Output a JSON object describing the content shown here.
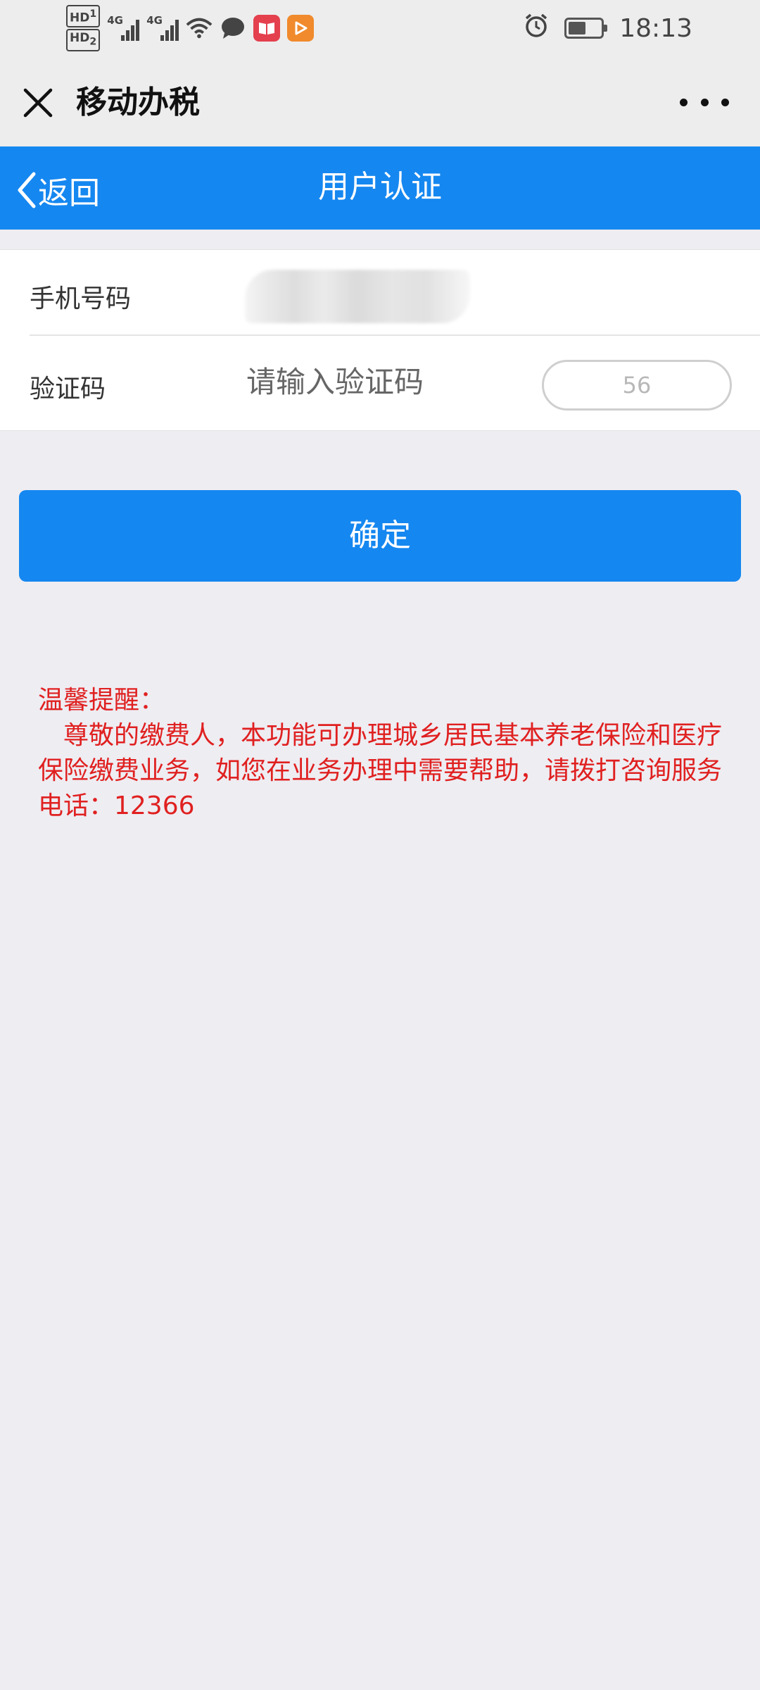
{
  "status_bar": {
    "hd1": "HD",
    "hd1_sub": "1",
    "hd2": "HD",
    "hd2_sub": "2",
    "signal1_label": "4G",
    "signal2_label": "4G",
    "time": "18:13",
    "battery_level": 0.55,
    "icons": [
      "wifi-icon",
      "chat-icon",
      "book-app-icon",
      "video-app-icon",
      "alarm-icon",
      "battery-icon"
    ]
  },
  "wechat_nav": {
    "title": "移动办税",
    "close_icon": "close-icon",
    "more_icon": "more-icon"
  },
  "header": {
    "back_label": "返回",
    "title": "用户认证",
    "color": "#1587f0"
  },
  "form": {
    "phone_label": "手机号码",
    "phone_value_obscured": true,
    "code_label": "验证码",
    "code_placeholder": "请输入验证码",
    "code_value": "",
    "countdown": "56"
  },
  "confirm_button": {
    "label": "确定"
  },
  "notice": {
    "title": "温馨提醒：",
    "body": "尊敬的缴费人，本功能可办理城乡居民基本养老保险和医疗保险缴费业务，如您在业务办理中需要帮助，请拨打咨询服务电话：12366",
    "color": "#e02020"
  }
}
